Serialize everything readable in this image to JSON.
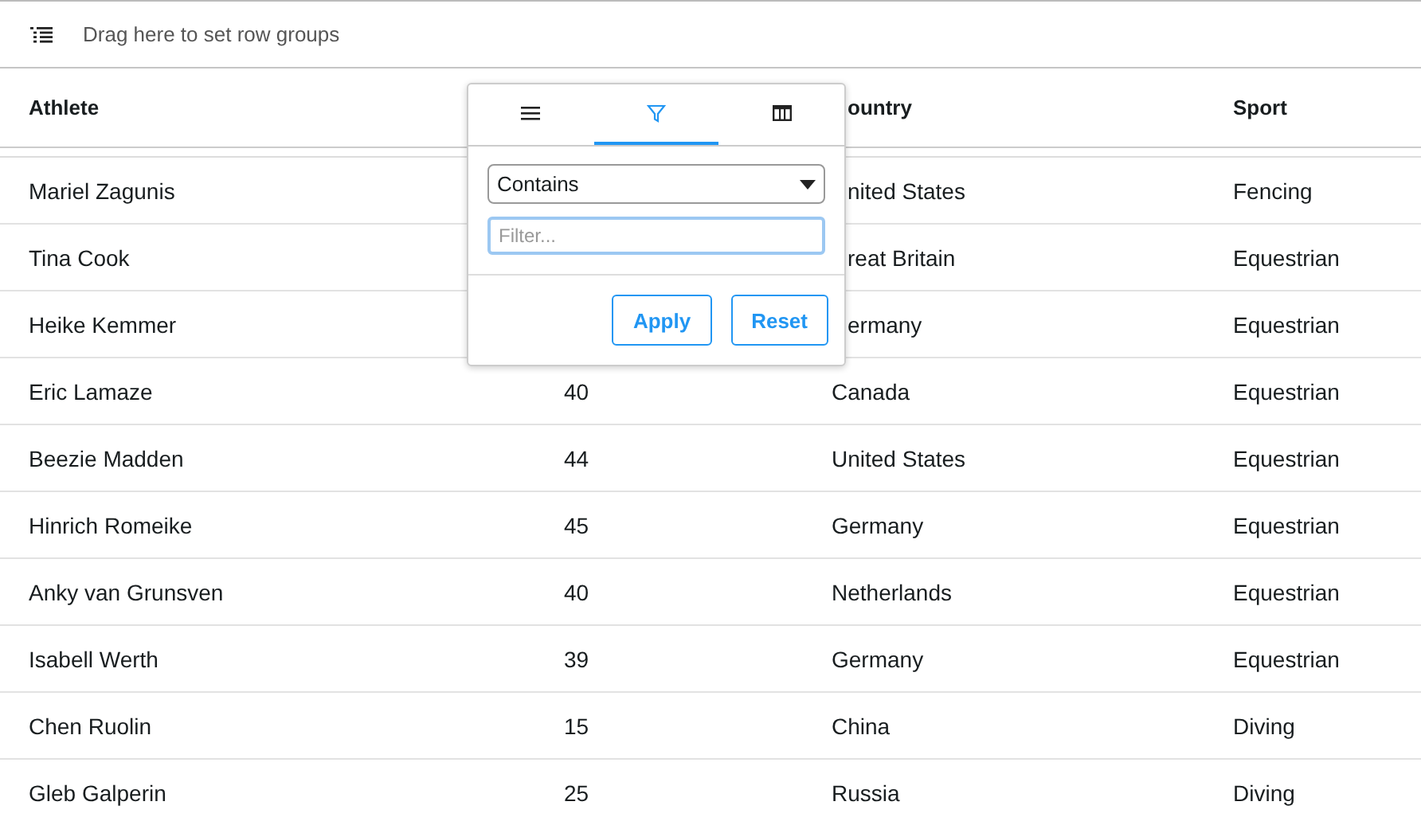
{
  "group_bar": {
    "hint": "Drag here to set row groups"
  },
  "columns": [
    {
      "label": "Athlete"
    },
    {},
    {
      "label": "ountry"
    },
    {
      "label": "Sport"
    }
  ],
  "rows": [
    {
      "athlete": "Mariel Zagunis",
      "country": "nited States",
      "sport": "Fencing"
    },
    {
      "athlete": "Tina Cook",
      "country": "reat Britain",
      "sport": "Equestrian"
    },
    {
      "athlete": "Heike Kemmer",
      "country": "ermany",
      "sport": "Equestrian"
    },
    {
      "athlete": "Eric Lamaze",
      "age": "40",
      "country": "Canada",
      "sport": "Equestrian"
    },
    {
      "athlete": "Beezie Madden",
      "age": "44",
      "country": "United States",
      "sport": "Equestrian"
    },
    {
      "athlete": "Hinrich Romeike",
      "age": "45",
      "country": "Germany",
      "sport": "Equestrian"
    },
    {
      "athlete": "Anky van Grunsven",
      "age": "40",
      "country": "Netherlands",
      "sport": "Equestrian"
    },
    {
      "athlete": "Isabell Werth",
      "age": "39",
      "country": "Germany",
      "sport": "Equestrian"
    },
    {
      "athlete": "Chen Ruolin",
      "age": "15",
      "country": "China",
      "sport": "Diving"
    },
    {
      "athlete": "Gleb Galperin",
      "age": "25",
      "country": "Russia",
      "sport": "Diving"
    }
  ],
  "filter_menu": {
    "tabs": [
      {
        "kind": "menu",
        "selected": false
      },
      {
        "kind": "filter",
        "selected": true
      },
      {
        "kind": "columns",
        "selected": false
      }
    ],
    "condition": "Contains",
    "placeholder": "Filter...",
    "buttons": [
      "Apply",
      "Reset"
    ]
  }
}
